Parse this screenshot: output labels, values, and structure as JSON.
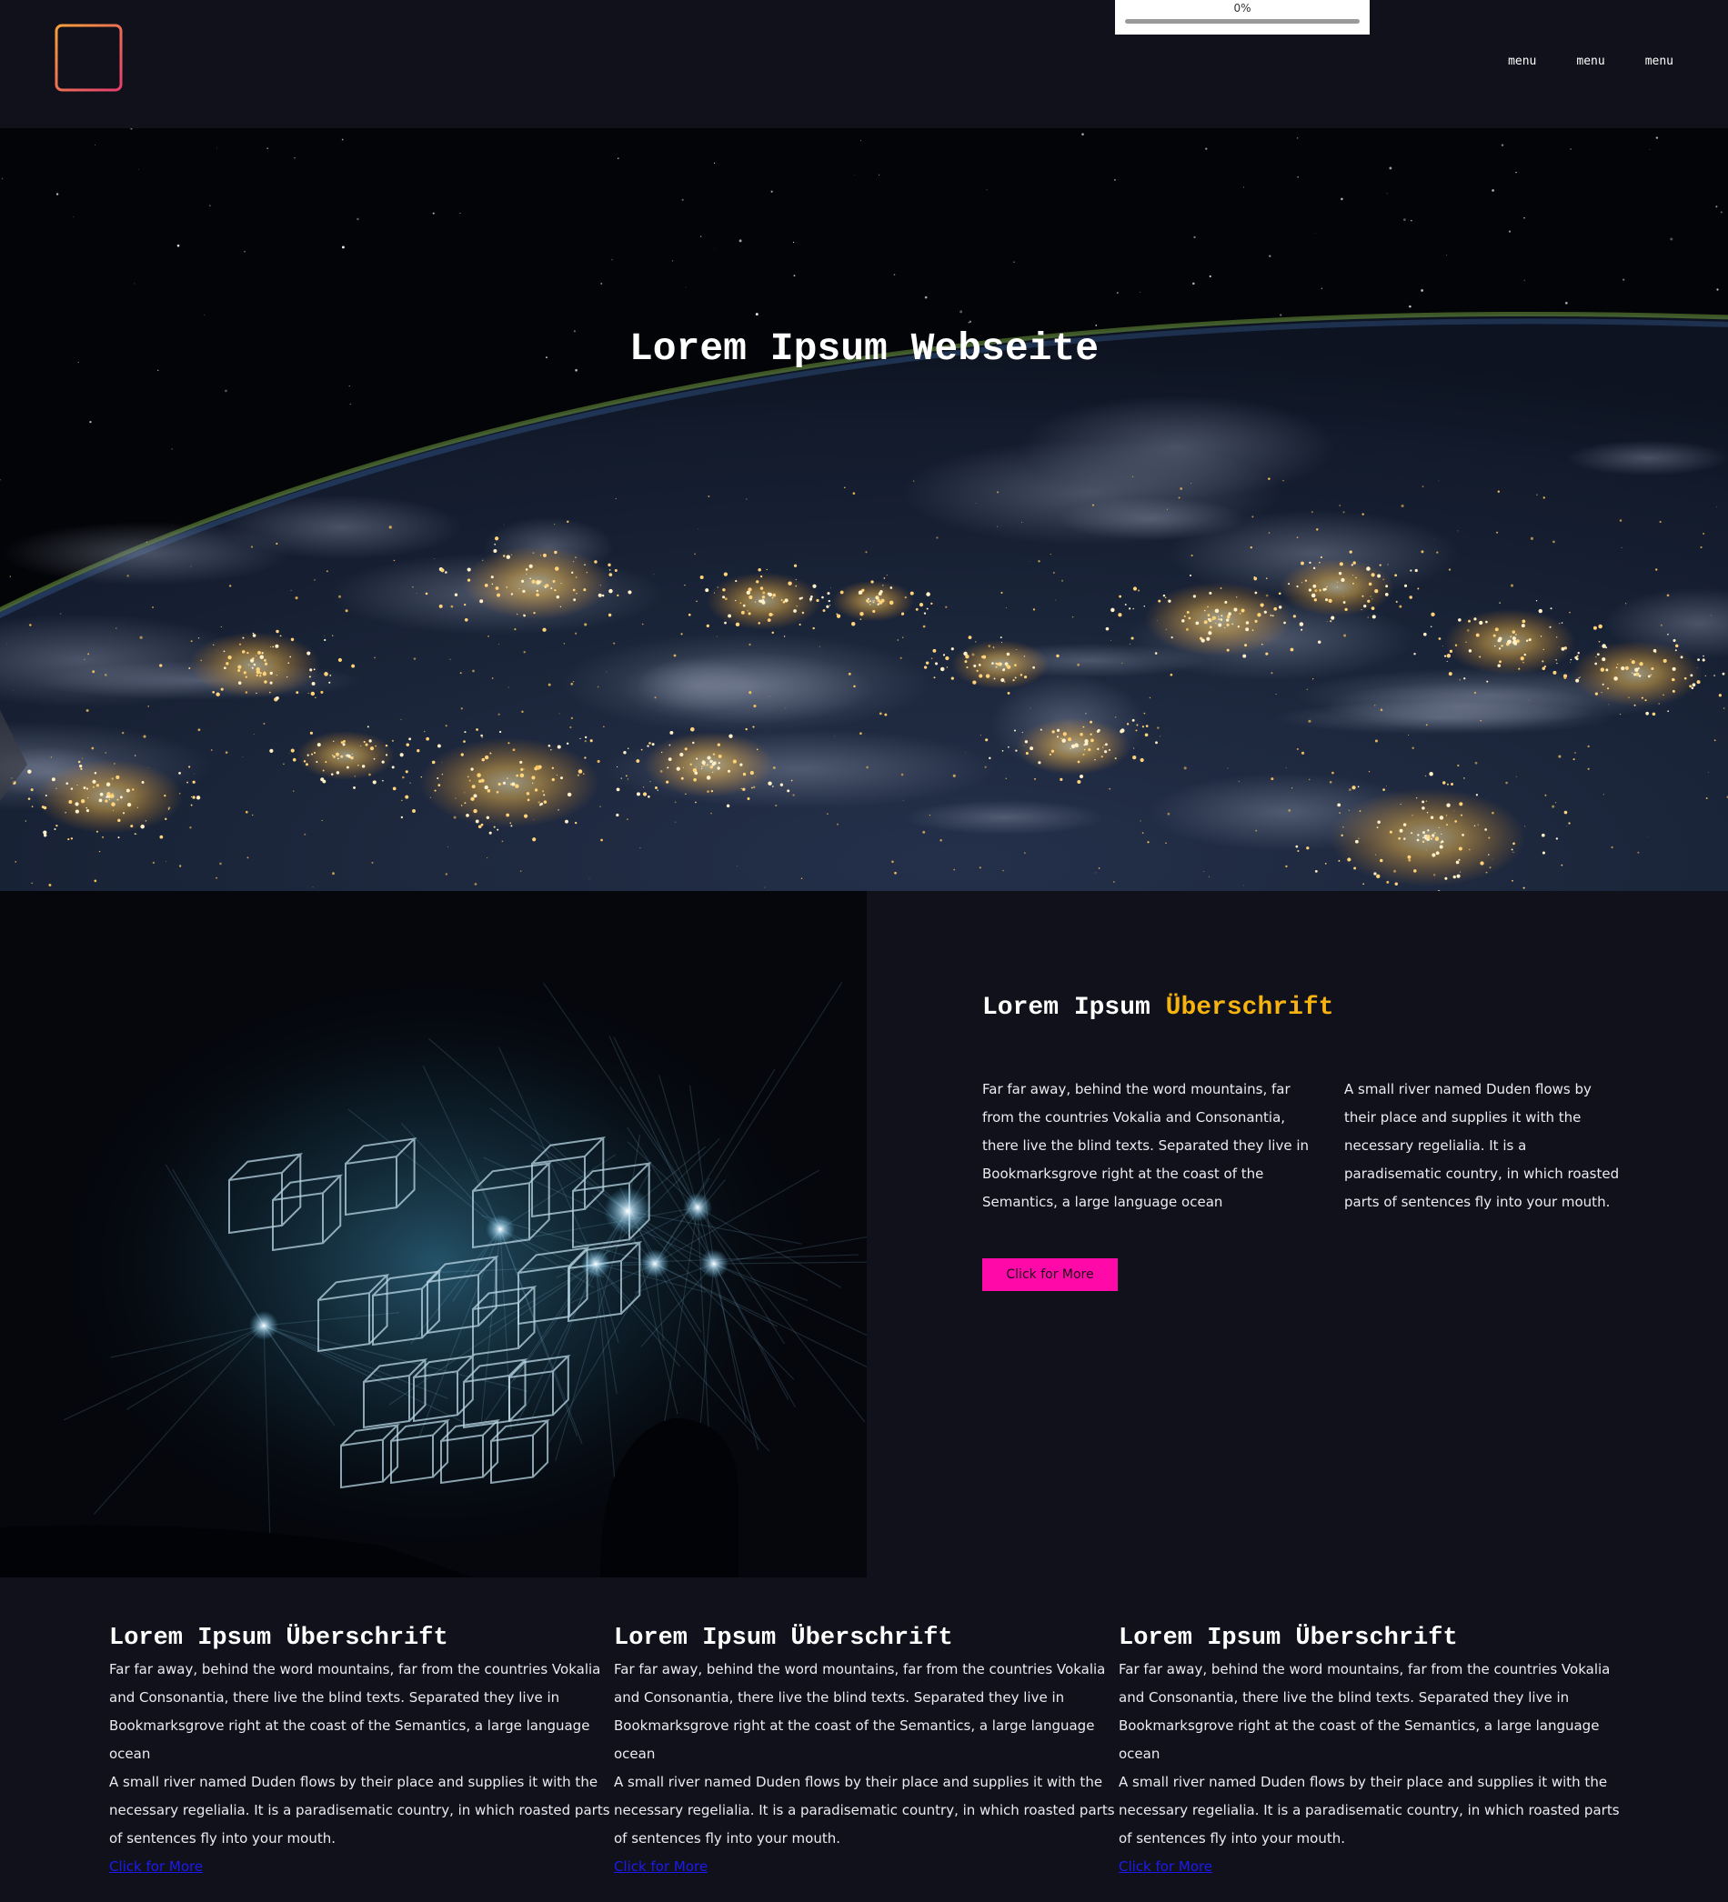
{
  "header": {
    "progress_label": "0%",
    "progress_fraction": 0,
    "nav": [
      "menu",
      "menu",
      "menu"
    ]
  },
  "hero": {
    "title": "Lorem Ipsum Webseite"
  },
  "feature": {
    "heading_main": "Lorem Ipsum ",
    "heading_accent": "Überschrift",
    "col1": "Far far away, behind the word mountains, far from the countries Vokalia and Consonantia, there live the blind texts. Separated they live in Bookmarksgrove right at the coast of the Semantics, a large language ocean",
    "col2": "A small river named Duden flows by their place and supplies it with the necessary regelialia. It is a paradisematic country, in which roasted parts of sentences fly into your mouth.",
    "button": "Click for More"
  },
  "cards": [
    {
      "title": "Lorem Ipsum Überschrift",
      "text1": "Far far away, behind the word mountains, far from the countries Vokalia and Consonantia, there live the blind texts. Separated they live in Bookmarksgrove right at the coast of the Semantics, a large language ocean",
      "text2": "A small river named Duden flows by their place and supplies it with the necessary regelialia. It is a paradisematic country, in which roasted parts of sentences fly into your mouth.",
      "link": "Click for More"
    },
    {
      "title": "Lorem Ipsum Überschrift",
      "text1": "Far far away, behind the word mountains, far from the countries Vokalia and Consonantia, there live the blind texts. Separated they live in Bookmarksgrove right at the coast of the Semantics, a large language ocean",
      "text2": "A small river named Duden flows by their place and supplies it with the necessary regelialia. It is a paradisematic country, in which roasted parts of sentences fly into your mouth.",
      "link": "Click for More"
    },
    {
      "title": "Lorem Ipsum Überschrift",
      "text1": "Far far away, behind the word mountains, far from the countries Vokalia and Consonantia, there live the blind texts. Separated they live in Bookmarksgrove right at the coast of the Semantics, a large language ocean",
      "text2": "A small river named Duden flows by their place and supplies it with the necessary regelialia. It is a paradisematic country, in which roasted parts of sentences fly into your mouth.",
      "link": "Click for More"
    }
  ],
  "colors": {
    "background": "#10111b",
    "accent_yellow": "#f7b30f",
    "button_pink": "#ff0aa8",
    "link_blue": "#1d1af0"
  },
  "icons": {
    "logo": "grid-logo-icon"
  }
}
